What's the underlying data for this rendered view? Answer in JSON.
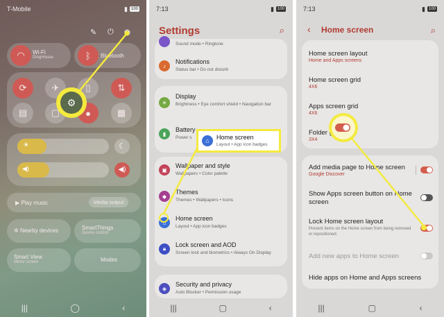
{
  "panel1": {
    "carrier": "T-Mobile",
    "battery": "100",
    "wifi": {
      "label": "Wi-Fi",
      "sub": "DingHouse"
    },
    "bluetooth": {
      "label": "Bluetooth"
    },
    "media_play": "Play music",
    "media_output": "Media output",
    "nearby": "Nearby devices",
    "smartthings": {
      "label": "SmartThings",
      "sub": "Device control"
    },
    "smartview": {
      "label": "Smart View",
      "sub": "Mirror screen"
    },
    "modes": "Modes",
    "brightness_level": 0.32,
    "volume_level": 0.35
  },
  "panel2": {
    "time": "7:13",
    "battery": "100",
    "title": "Settings",
    "items": [
      {
        "title": "",
        "sub": "Sound mode  •  Ringtone"
      },
      {
        "title": "Notifications",
        "sub": "Status bar  •  Do not disturb"
      },
      {
        "title": "Display",
        "sub": "Brightness  •  Eye comfort shield  •  Navigation bar"
      },
      {
        "title": "Battery",
        "sub": "Power s"
      },
      {
        "title": "Wallpaper and style",
        "sub": "Wallpapers  •  Color palette"
      },
      {
        "title": "Themes",
        "sub": "Themes  •  Wallpapers  •  Icons"
      },
      {
        "title": "Home screen",
        "sub": "Layout  •  App icon badges"
      },
      {
        "title": "Lock screen and AOD",
        "sub": "Screen lock and biometrics  •  Always On Display"
      },
      {
        "title": "Security and privacy",
        "sub": "Auto Blocker  •  Permission usage"
      }
    ],
    "callout": {
      "title": "Home screen",
      "sub": "Layout  •  App icon badges"
    }
  },
  "panel3": {
    "time": "7:13",
    "battery": "100",
    "title": "Home screen",
    "items": [
      {
        "title": "Home screen layout",
        "sub": "Home and Apps screens"
      },
      {
        "title": "Home screen grid",
        "sub": "4X6"
      },
      {
        "title": "Apps screen grid",
        "sub": "4X6"
      },
      {
        "title": "Folder g",
        "sub": "3X4"
      },
      {
        "title": "Add media page to Home screen",
        "sub": "Google Discover"
      },
      {
        "title": "Show Apps screen button on Home screen",
        "sub": ""
      },
      {
        "title": "Lock Home screen layout",
        "sub": "Prevent items on the Home screen from being removed or repositioned."
      },
      {
        "title": "Add new apps to Home screen",
        "sub": ""
      },
      {
        "title": "Hide apps on Home and Apps screens",
        "sub": ""
      }
    ]
  },
  "colors": {
    "accent": "#b13b32",
    "highlight": "#f4ea3e",
    "toggle_on": "#d45d4c"
  }
}
